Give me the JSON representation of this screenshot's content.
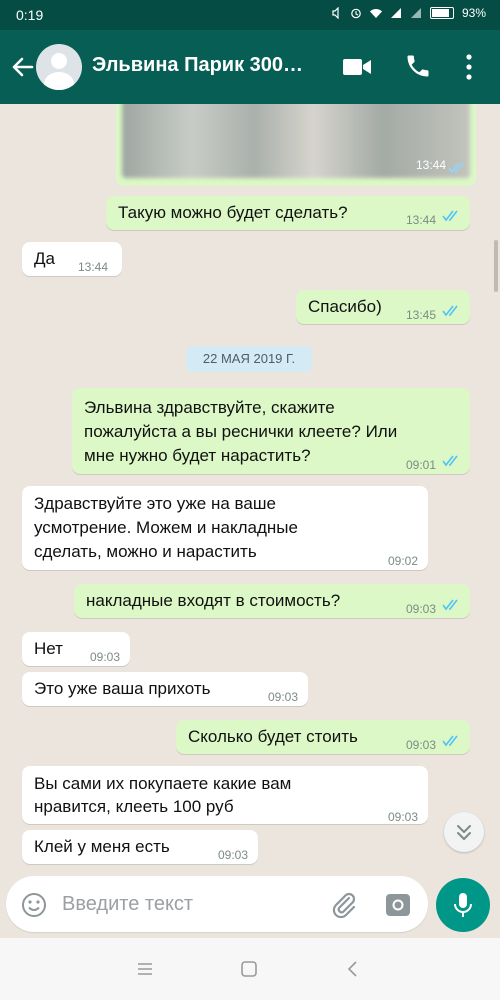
{
  "status_bar": {
    "time": "0:19",
    "battery": "93%"
  },
  "header": {
    "title": "Эльвина Парик 300…"
  },
  "messages": [
    {
      "text": "Такую можно будет сделать?",
      "time": "13:44"
    },
    {
      "text": "Да",
      "time": "13:44"
    },
    {
      "text": "Спасибо)",
      "time": "13:45"
    },
    {
      "text": "Эльвина здравствуйте, скажите\nпожалуйста а вы реснички клеете? Или\nмне нужно будет нарастить?",
      "time": "09:01"
    },
    {
      "text": "Здравствуйте это уже на ваше\nусмотрение. Можем и накладные\nсделать, можно и нарастить",
      "time": "09:02"
    },
    {
      "text": "накладные входят в стоимость?",
      "time": "09:03"
    },
    {
      "text": "Нет",
      "time": "09:03"
    },
    {
      "text": "Это уже ваша прихоть",
      "time": "09:03"
    },
    {
      "text": "Сколько будет стоить",
      "time": "09:03"
    },
    {
      "text": "Вы сами их покупаете какие вам\nнравится, клееть 100 руб",
      "time": "09:03"
    },
    {
      "text": "Клей у меня есть",
      "time": "09:03"
    }
  ],
  "image_message": {
    "time": "13:44"
  },
  "date_separator": "22 МАЯ 2019 Г.",
  "input": {
    "placeholder": "Введите текст"
  },
  "colors": {
    "header": "#075E54",
    "outgoing_bubble": "#DCF8C6",
    "incoming_bubble": "#FFFFFF",
    "read_check": "#4FC3F7",
    "mic_button": "#009688"
  }
}
